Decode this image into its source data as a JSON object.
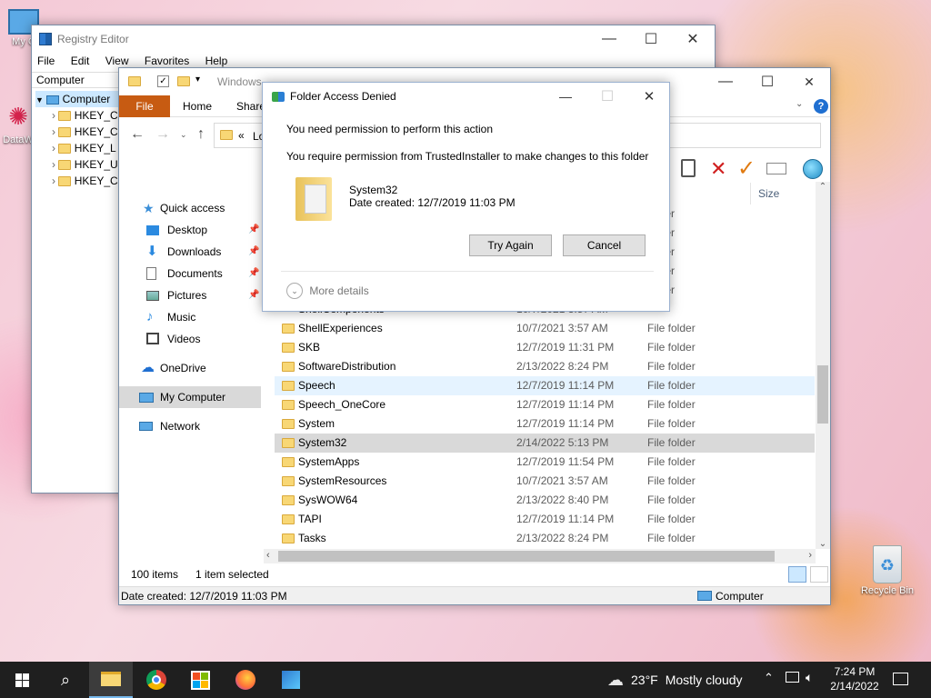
{
  "desktop": {
    "icons": [
      {
        "label": "My C"
      },
      {
        "label": "DataW"
      },
      {
        "label": "Recycle Bin"
      }
    ]
  },
  "registry": {
    "title": "Registry Editor",
    "menu": [
      "File",
      "Edit",
      "View",
      "Favorites",
      "Help"
    ],
    "address": "Computer",
    "tree_root": "Computer",
    "tree_items": [
      "HKEY_C",
      "HKEY_C",
      "HKEY_L",
      "HKEY_U",
      "HKEY_C"
    ]
  },
  "explorer": {
    "title": "Windows",
    "ribbon_tabs": [
      "File",
      "Home",
      "Share"
    ],
    "address_chevron": "«",
    "address_text": "Lo",
    "size_header": "Size",
    "nav": {
      "quick_access": "Quick access",
      "items": [
        {
          "label": "Desktop",
          "pinned": true
        },
        {
          "label": "Downloads",
          "pinned": true
        },
        {
          "label": "Documents",
          "pinned": true
        },
        {
          "label": "Pictures",
          "pinned": true
        },
        {
          "label": "Music",
          "pinned": false
        },
        {
          "label": "Videos",
          "pinned": false
        }
      ],
      "onedrive": "OneDrive",
      "my_computer": "My Computer",
      "network": "Network"
    },
    "hidden_rows_type": [
      "folder",
      "folder",
      "folder",
      "folder",
      "folder"
    ],
    "partial_row": {
      "name": "ShellComponents",
      "date": "10/7/2021 3:57 AM"
    },
    "files": [
      {
        "name": "ShellExperiences",
        "date": "10/7/2021 3:57 AM",
        "type": "File folder"
      },
      {
        "name": "SKB",
        "date": "12/7/2019 11:31 PM",
        "type": "File folder"
      },
      {
        "name": "SoftwareDistribution",
        "date": "2/13/2022 8:24 PM",
        "type": "File folder"
      },
      {
        "name": "Speech",
        "date": "12/7/2019 11:14 PM",
        "type": "File folder"
      },
      {
        "name": "Speech_OneCore",
        "date": "12/7/2019 11:14 PM",
        "type": "File folder"
      },
      {
        "name": "System",
        "date": "12/7/2019 11:14 PM",
        "type": "File folder"
      },
      {
        "name": "System32",
        "date": "2/14/2022 5:13 PM",
        "type": "File folder"
      },
      {
        "name": "SystemApps",
        "date": "12/7/2019 11:54 PM",
        "type": "File folder"
      },
      {
        "name": "SystemResources",
        "date": "10/7/2021 3:57 AM",
        "type": "File folder"
      },
      {
        "name": "SysWOW64",
        "date": "2/13/2022 8:40 PM",
        "type": "File folder"
      },
      {
        "name": "TAPI",
        "date": "12/7/2019 11:14 PM",
        "type": "File folder"
      },
      {
        "name": "Tasks",
        "date": "2/13/2022 8:24 PM",
        "type": "File folder"
      }
    ],
    "status_items": "100 items",
    "status_selected": "1 item selected",
    "details_bar": "Date created: 12/7/2019 11:03 PM",
    "details_location": "Computer",
    "colors": {
      "accent": "#c75b12",
      "selected_row": "#d9d9d9",
      "hover_row": "#e5f3ff"
    }
  },
  "dialog": {
    "title": "Folder Access Denied",
    "heading": "You need permission to perform this action",
    "message": "You require permission from TrustedInstaller to make changes to this folder",
    "item_name": "System32",
    "item_date": "Date created: 12/7/2019 11:03 PM",
    "try_again": "Try Again",
    "cancel": "Cancel",
    "more_details": "More details"
  },
  "taskbar": {
    "weather_temp": "23°F",
    "weather_desc": "Mostly cloudy",
    "time": "7:24 PM",
    "date": "2/14/2022"
  }
}
